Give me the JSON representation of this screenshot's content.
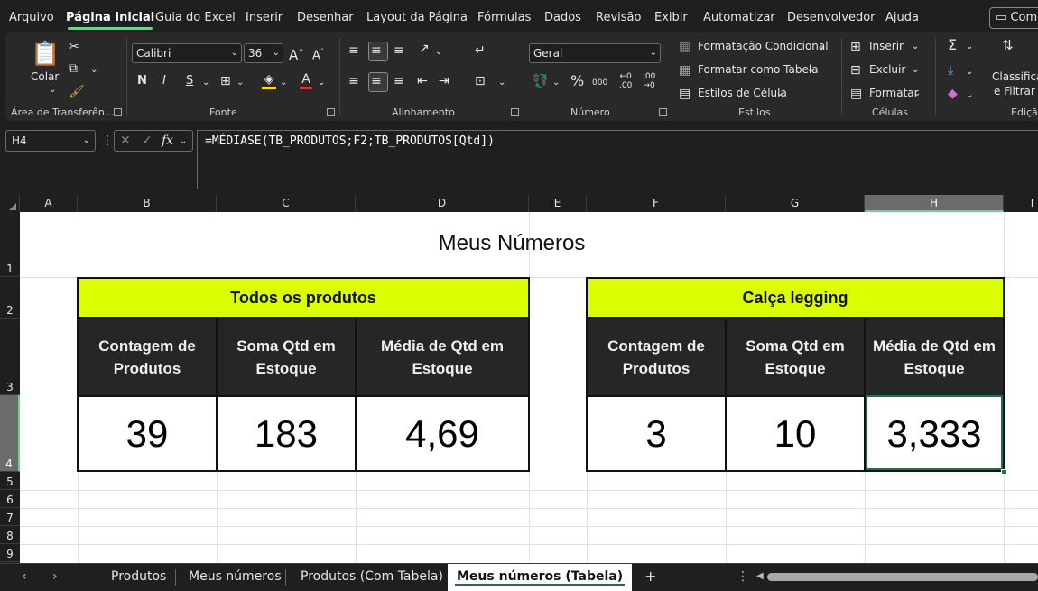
{
  "menu": {
    "tabs": [
      "Arquivo",
      "Página Inicial",
      "Guia do Excel",
      "Inserir",
      "Desenhar",
      "Layout da Página",
      "Fórmulas",
      "Dados",
      "Revisão",
      "Exibir",
      "Automatizar",
      "Desenvolvedor",
      "Ajuda"
    ],
    "active_tab": "Página Inicial",
    "comments_label": "Come"
  },
  "ribbon": {
    "clipboard": {
      "paste_label": "Colar",
      "group_label": "Área de Transferên..."
    },
    "font": {
      "font_name": "Calibri",
      "font_size": "36",
      "group_label": "Fonte",
      "bold": "N",
      "italic": "I",
      "underline": "S"
    },
    "alignment": {
      "group_label": "Alinhamento"
    },
    "number": {
      "format": "Geral",
      "group_label": "Número"
    },
    "styles": {
      "conditional": "Formatação Condicional",
      "as_table": "Formatar como Tabela",
      "cell_styles": "Estilos de Célula",
      "group_label": "Estilos"
    },
    "cells": {
      "insert": "Inserir",
      "delete": "Excluir",
      "format": "Formatar",
      "group_label": "Células"
    },
    "editing": {
      "sort_line1": "Classificar",
      "sort_line2": "e Filtrar",
      "group_label": "Ediçã"
    }
  },
  "formula_bar": {
    "name_box": "H4",
    "formula": "=MÉDIASE(TB_PRODUTOS;F2;TB_PRODUTOS[Qtd])"
  },
  "grid": {
    "columns": [
      "A",
      "B",
      "C",
      "D",
      "E",
      "F",
      "G",
      "H",
      "I"
    ],
    "rows": [
      "1",
      "2",
      "3",
      "4",
      "5",
      "6",
      "7",
      "8",
      "9"
    ],
    "selected_column": "H",
    "selected_row": "4"
  },
  "sheet": {
    "title": "Meus Números",
    "table_all": {
      "header": "Todos os produtos",
      "columns": [
        "Contagem de Produtos",
        "Soma Qtd em Estoque",
        "Média de Qtd em Estoque"
      ],
      "values": [
        "39",
        "183",
        "4,69"
      ]
    },
    "table_legging": {
      "header": "Calça legging",
      "columns": [
        "Contagem de Produtos",
        "Soma Qtd em Estoque",
        "Média de Qtd em Estoque"
      ],
      "values": [
        "3",
        "10",
        "3,333"
      ]
    }
  },
  "tabs": {
    "sheets": [
      "Produtos",
      "Meus números",
      "Produtos (Com Tabela)",
      "Meus números (Tabela)"
    ],
    "active": "Meus números (Tabela)",
    "add_label": "+"
  }
}
